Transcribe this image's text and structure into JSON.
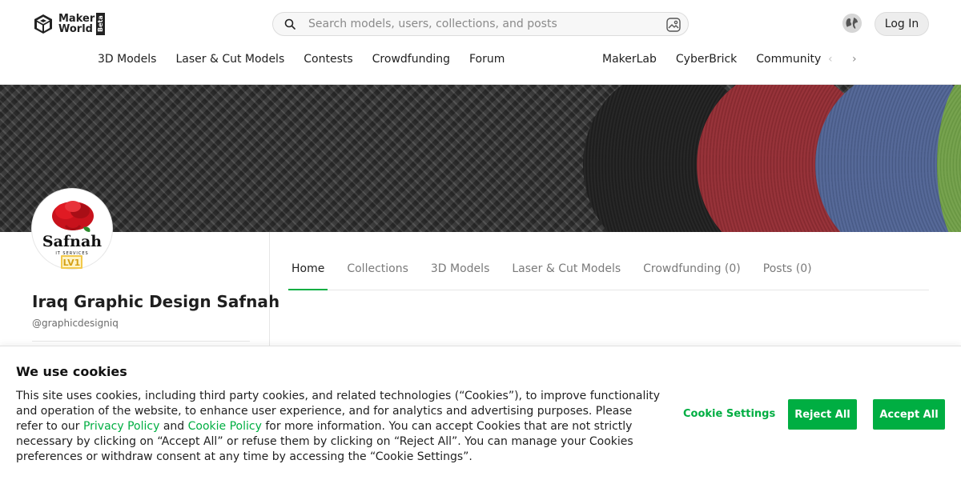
{
  "header": {
    "logo_text_line1": "Maker",
    "logo_text_line2": "World",
    "logo_badge": "Beta",
    "search_placeholder": "Search models, users, collections, and posts",
    "login_label": "Log In"
  },
  "nav": {
    "left": [
      "3D Models",
      "Laser & Cut Models",
      "Contests",
      "Crowdfunding",
      "Forum"
    ],
    "right": [
      "MakerLab",
      "CyberBrick",
      "Community"
    ],
    "prev_arrow": "‹",
    "next_arrow": "›"
  },
  "profile": {
    "avatar_text": "Safnah",
    "avatar_subtext": "IT SERVICES",
    "level_badge": "LV1",
    "name": "Iraq Graphic Design Safnah",
    "handle": "@graphicdesigniq"
  },
  "tabs": [
    "Home",
    "Collections",
    "3D Models",
    "Laser & Cut Models",
    "Crowdfunding (0)",
    "Posts (0)"
  ],
  "active_tab": "Home",
  "cookie": {
    "title": "We use cookies",
    "body_part1": "This site uses cookies, including third party cookies, and related technologies (“Cookies”), to improve functionality and operation of the website, to enhance user experience, and for analytics and advertising purposes. Please refer to our ",
    "privacy_link": "Privacy Policy",
    "and": " and ",
    "cookie_link": "Cookie Policy",
    "body_part2": " for more information. You can accept Cookies that are not strictly necessary by clicking on “Accept All” or refuse them by clicking on “Reject All”. You can manage your Cookies preferences or withdraw consent at any time by accessing the “Cookie Settings”.",
    "settings_label": "Cookie Settings",
    "reject_label": "Reject All",
    "accept_label": "Accept All"
  },
  "colors": {
    "accent": "#00ae42",
    "text": "#1f1f1f",
    "muted": "#7a7a7a"
  }
}
